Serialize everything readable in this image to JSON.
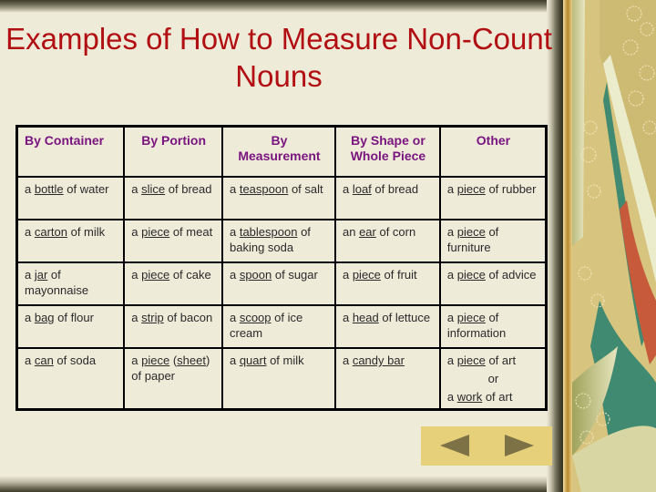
{
  "title": "Examples of How to Measure Non-Count Nouns",
  "table": {
    "headers": [
      "By Container",
      "By Portion",
      "By Measurement",
      "By Shape or Whole Piece",
      "Other"
    ],
    "rows": [
      [
        {
          "pre": "a ",
          "unit": "bottle",
          "post": " of water"
        },
        {
          "pre": "a ",
          "unit": "slice",
          "post": " of bread"
        },
        {
          "pre": "a ",
          "unit": "teaspoon",
          "post": " of salt"
        },
        {
          "pre": "a ",
          "unit": "loaf",
          "post": " of bread"
        },
        {
          "pre": "a ",
          "unit": "piece",
          "post": " of rubber"
        }
      ],
      [
        {
          "pre": "a ",
          "unit": "carton",
          "post": " of milk"
        },
        {
          "pre": "a ",
          "unit": "piece",
          "post": " of meat"
        },
        {
          "pre": "a ",
          "unit": "tablespoon",
          "post": " of baking soda"
        },
        {
          "pre": "an ",
          "unit": "ear",
          "post": " of corn"
        },
        {
          "pre": "a ",
          "unit": "piece",
          "post": " of furniture"
        }
      ],
      [
        {
          "pre": "a ",
          "unit": "jar",
          "post": " of mayonnaise"
        },
        {
          "pre": "a ",
          "unit": "piece",
          "post": " of cake"
        },
        {
          "pre": "a ",
          "unit": "spoon",
          "post": " of sugar"
        },
        {
          "pre": "a ",
          "unit": "piece",
          "post": " of fruit"
        },
        {
          "pre": "a ",
          "unit": "piece",
          "post": " of advice"
        }
      ],
      [
        {
          "pre": "a ",
          "unit": "bag",
          "post": " of flour"
        },
        {
          "pre": "a ",
          "unit": "strip",
          "post": " of bacon"
        },
        {
          "pre": "a ",
          "unit": "scoop",
          "post": " of ice cream"
        },
        {
          "pre": "a ",
          "unit": "head",
          "post": " of lettuce"
        },
        {
          "pre": "a ",
          "unit": "piece",
          "post": " of information"
        }
      ],
      [
        {
          "pre": "a ",
          "unit": "can",
          "post": " of soda"
        },
        {
          "pre": "a ",
          "unit": "piece",
          "mid": " (",
          "unit2": "sheet",
          "post": ") of paper"
        },
        {
          "pre": "a ",
          "unit": "quart",
          "post": " of milk"
        },
        {
          "pre": "a ",
          "unit": "candy bar",
          "post": ""
        },
        {
          "pre": "a ",
          "unit": "piece",
          "post": " of art",
          "or": "or",
          "pre2": "a ",
          "unit3": "work",
          "post2": " of art"
        }
      ]
    ]
  },
  "nav": {
    "prev_icon": "triangle-left-icon",
    "next_icon": "triangle-right-icon"
  },
  "colors": {
    "title": "#b10f12",
    "header_text": "#7a1580",
    "background": "#efebd9",
    "nav_bar": "#e6d07a",
    "nav_arrow": "#7d7246"
  }
}
